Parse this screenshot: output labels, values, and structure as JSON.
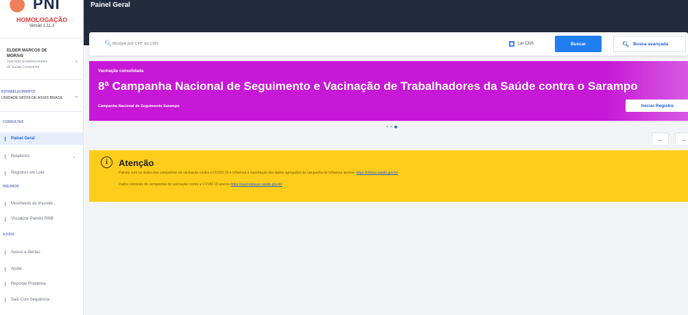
{
  "brand": {
    "logo_text": "PNI",
    "environment": "HOMOLOGAÇÃO",
    "version": "Versão 1.11.3"
  },
  "user": {
    "name_line1": "ELDER MARCOS DE",
    "name_line2": "MORAIS",
    "role_line1": "Operador Estabelecimento",
    "role_line2": "de Saúde Campanha"
  },
  "establishment": {
    "label": "ESTABELECIMENTO",
    "name": "UNIDADE MISTA DE ASSIS BRASIL"
  },
  "sidebar": {
    "section_main": "CONSULTAS",
    "items_main": [
      {
        "label": "Painel Geral"
      },
      {
        "label": "Relatórios"
      },
      {
        "label": "Registros em Lote"
      }
    ],
    "section_insumos": "INSUMOS",
    "items_insumos": [
      {
        "label": "Movimento de Imunobi..."
      },
      {
        "label": "Visualizar Painéis RNB"
      }
    ],
    "section_help": "AJUDA",
    "items_help": [
      {
        "label": "Avisos e Alertas"
      },
      {
        "label": "Ajuda"
      },
      {
        "label": "Reportar Problema"
      },
      {
        "label": "Sais Com Sequência"
      }
    ]
  },
  "header": {
    "title": "Painel Geral"
  },
  "search": {
    "placeholder": "Busque por CPF ou CNS",
    "read_cns_label": "Ler CNS",
    "search_button": "Buscar",
    "advanced_button": "Busca avançada"
  },
  "banner": {
    "kicker": "Vacinação consolidada",
    "title": "8ª Campanha Nacional de Seguimento e Vacinação de Trabalhadores da Saúde contra o Sarampo",
    "subtitle": "Campanha Nacional de Seguimento Sarampo",
    "action_button": "Iniciar Registro",
    "color": "#c618d6"
  },
  "carousel": {
    "prev_arrow": "←",
    "next_arrow": "→"
  },
  "alert": {
    "title": "Atenção",
    "icon_glyph": "i",
    "line1_text": "Painéis com os dados das campanhas de vacinação contra a COVID-19 e Influenza e exportação dos dados agregados da campanha de Influenza acesse: ",
    "line1_link": "https://infoms.saude.gov.br/",
    "line2_text": "Dados nominais de campanhas de vacinação contra a COVID-19 acesse ",
    "line2_link": "https://opendatasus.saude.gov.br/",
    "color": "#fecd1b"
  }
}
